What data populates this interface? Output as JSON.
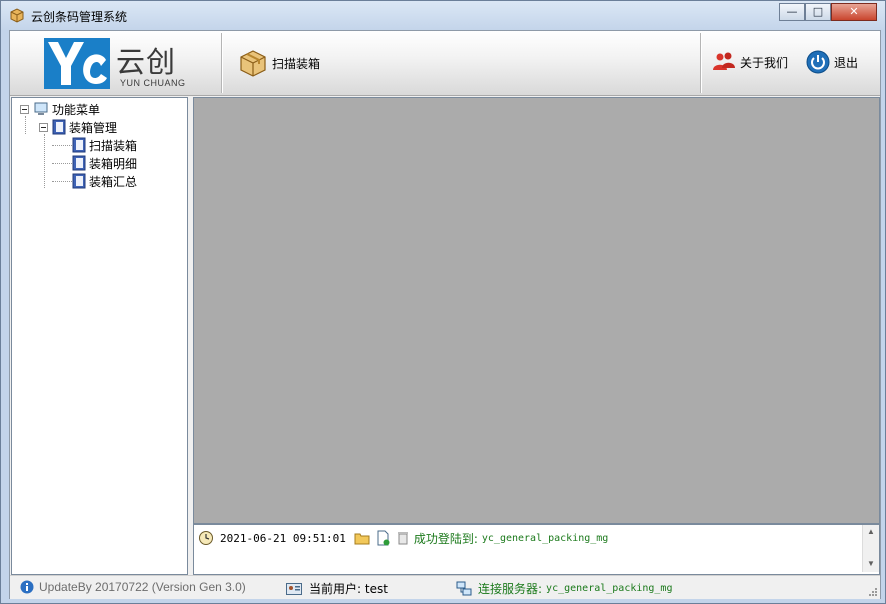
{
  "window": {
    "title": "云创条码管理系统",
    "controls": {
      "minimize": "—",
      "maximize": "□",
      "close": "✕"
    }
  },
  "toolbar": {
    "logo_text": "云创",
    "logo_subtext": "YUN CHUANG",
    "logo_letters": "YC",
    "scan_pack_label": "扫描装箱",
    "about_label": "关于我们",
    "exit_label": "退出"
  },
  "tree": {
    "root": "功能菜单",
    "group": "装箱管理",
    "items": [
      "扫描装箱",
      "装箱明细",
      "装箱汇总"
    ]
  },
  "log": {
    "timestamp": "2021-06-21 09:51:01",
    "message": "成功登陆到:",
    "server": "yc_general_packing_mg"
  },
  "status": {
    "version": "UpdateBy 20170722 (Version Gen 3.0)",
    "current_user": "当前用户: test",
    "server_label": "连接服务器:",
    "server_name": "yc_general_packing_mg"
  },
  "colors": {
    "accent_blue": "#1a7fc8",
    "status_green": "#1c7a1c",
    "work_area": "#ababab"
  },
  "icons": {
    "title": "package-icon",
    "scan_pack": "box-icon",
    "about": "people-icon",
    "exit": "power-icon",
    "tree_root": "computer-icon",
    "tree_items": "book-icon",
    "log_time": "clock-icon",
    "log_folder": "folder-icon",
    "log_add": "document-add-icon",
    "log_delete": "trash-icon",
    "status_info": "info-icon",
    "status_user": "id-card-icon",
    "status_server": "network-icon"
  }
}
